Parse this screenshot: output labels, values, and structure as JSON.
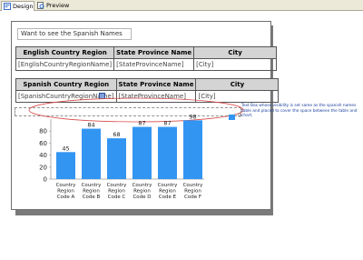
{
  "tabs": [
    {
      "label": "Design",
      "icon": "design-icon",
      "active": true
    },
    {
      "label": "Preview",
      "icon": "preview-icon",
      "active": false
    }
  ],
  "textbox_value": "Want to see the Spanish Names",
  "table1": {
    "headers": [
      "English Country Region",
      "State Province Name",
      "City"
    ],
    "row": [
      "[EnglishCountryRegionName]",
      "[StateProvinceName]",
      "[City]"
    ]
  },
  "table2": {
    "headers": [
      "Spanish Country Region",
      "State Province Name",
      "City"
    ],
    "row": [
      "[SpanishCountryRegionName]",
      "[StateProvinceName]",
      "[City]"
    ]
  },
  "annotation": "Text Box whose visibility is set same as the spanish names table and placed to cover the space between the table and chart.",
  "legend_label": "0",
  "colors": {
    "bar": "#3395f2",
    "annotation": "#d94a4a",
    "header_bg": "#d4d4d4"
  },
  "chart_data": {
    "type": "bar",
    "categories": [
      [
        "Country",
        "Region",
        "Code A"
      ],
      [
        "Country",
        "Region",
        "Code B"
      ],
      [
        "Country",
        "Region",
        "Code C"
      ],
      [
        "Country",
        "Region",
        "Code D"
      ],
      [
        "Country",
        "Region",
        "Code E"
      ],
      [
        "Country",
        "Region",
        "Code F"
      ]
    ],
    "values": [
      45,
      84,
      68,
      87,
      87,
      98
    ],
    "y_ticks": [
      "0",
      "20",
      "40",
      "60",
      "80"
    ],
    "ylim": [
      0,
      100
    ]
  }
}
